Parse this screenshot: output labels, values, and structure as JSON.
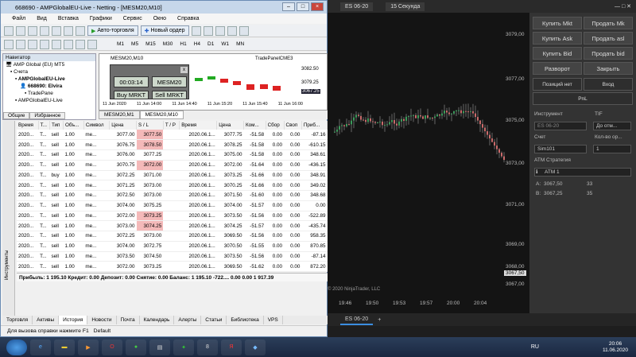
{
  "mt5": {
    "title": "668690 - AMPGlobalEU-Live - Netting - [MESM20,M10]",
    "menu": [
      "Файл",
      "Вид",
      "Вставка",
      "Графики",
      "Сервис",
      "Окно",
      "Справка"
    ],
    "toolbar": {
      "auto_trading": "Авто-торговля",
      "new_order": "Новый ордер"
    },
    "timeframes": [
      "M1",
      "M5",
      "M15",
      "M30",
      "H1",
      "H4",
      "D1",
      "W1",
      "MN"
    ],
    "navigator": {
      "title": "Навигатор",
      "items": [
        "AMP Global (EU) MT5",
        "Счета",
        "AMPGlobalEU-Live",
        "668690: Elvira",
        "TradePane",
        "AMPGlobalEU-Live"
      ],
      "tabs": [
        "Общие",
        "Избранное"
      ]
    },
    "chart": {
      "symbol": "MESM20,M10",
      "panel_label": "TradePanelCME3",
      "price_top": "3082.50",
      "price_mid": "3079.25",
      "price_current": "3067.25",
      "times": [
        "11 Jun 2020",
        "11 Jun 14:00",
        "11 Jun 14:40",
        "11 Jun 15:20",
        "11 Jun 15:40",
        "11 Jun 16:00"
      ],
      "tabs": [
        "MESM20,M1",
        "MESM20,M10"
      ]
    },
    "tradepanel": {
      "timer": "00:03:14",
      "symbol": "MESM20",
      "buy": "Buy MRKT",
      "sell": "Sell MRKT"
    },
    "table": {
      "headers": [
        "Время",
        "Т...",
        "Тип",
        "Объ...",
        "Символ",
        "Цена",
        "S / L",
        "T / P",
        "Время",
        "Цена",
        "Ком...",
        "Сбор",
        "Своп",
        "Приб..."
      ],
      "rows": [
        [
          "2020...",
          "T...",
          "sell",
          "1.00",
          "me...",
          "3077.00",
          "3077.50",
          "",
          "2020.06.1...",
          "3077.75",
          "-51.58",
          "0.00",
          "0.00",
          "-87.16"
        ],
        [
          "2020...",
          "T...",
          "sell",
          "1.00",
          "me...",
          "3076.75",
          "3078.50",
          "",
          "2020.06.1...",
          "3078.25",
          "-51.58",
          "0.00",
          "0.00",
          "-610.15"
        ],
        [
          "2020...",
          "T...",
          "sell",
          "1.00",
          "me...",
          "3076.00",
          "3077.25",
          "",
          "2020.06.1...",
          "3075.00",
          "-51.58",
          "0.00",
          "0.00",
          "348.61"
        ],
        [
          "2020...",
          "T...",
          "sell",
          "1.00",
          "me...",
          "3070.75",
          "3072.00",
          "",
          "2020.06.1...",
          "3072.00",
          "-51.64",
          "0.00",
          "0.00",
          "-436.15"
        ],
        [
          "2020...",
          "T...",
          "buy",
          "1.00",
          "me...",
          "3072.25",
          "3071.00",
          "",
          "2020.06.1...",
          "3073.25",
          "-51.66",
          "0.00",
          "0.00",
          "348.91"
        ],
        [
          "2020...",
          "T...",
          "sell",
          "1.00",
          "me...",
          "3071.25",
          "3073.00",
          "",
          "2020.06.1...",
          "3070.25",
          "-51.66",
          "0.00",
          "0.00",
          "349.02"
        ],
        [
          "2020...",
          "T...",
          "sell",
          "1.00",
          "me...",
          "3072.50",
          "3073.00",
          "",
          "2020.06.1...",
          "3071.50",
          "-51.60",
          "0.00",
          "0.00",
          "348.68"
        ],
        [
          "2020...",
          "T...",
          "sell",
          "1.00",
          "me...",
          "3074.00",
          "3075.25",
          "",
          "2020.06.1...",
          "3074.00",
          "-51.57",
          "0.00",
          "0.00",
          "0.00"
        ],
        [
          "2020...",
          "T...",
          "sell",
          "1.00",
          "me...",
          "3072.00",
          "3073.25",
          "",
          "2020.06.1...",
          "3073.50",
          "-51.56",
          "0.00",
          "0.00",
          "-522.89"
        ],
        [
          "2020...",
          "T...",
          "sell",
          "1.00",
          "me...",
          "3073.00",
          "3074.25",
          "",
          "2020.06.1...",
          "3074.25",
          "-51.57",
          "0.00",
          "0.00",
          "-435.74"
        ],
        [
          "2020...",
          "T...",
          "sell",
          "1.00",
          "me...",
          "3072.25",
          "3073.00",
          "",
          "2020.06.1...",
          "3069.50",
          "-51.56",
          "0.00",
          "0.00",
          "958.35"
        ],
        [
          "2020...",
          "T...",
          "sell",
          "1.00",
          "me...",
          "3074.00",
          "3072.75",
          "",
          "2020.06.1...",
          "3070.50",
          "-51.55",
          "0.00",
          "0.00",
          "870.85"
        ],
        [
          "2020...",
          "T...",
          "sell",
          "1.00",
          "me...",
          "3073.50",
          "3074.50",
          "",
          "2020.06.1...",
          "3073.50",
          "-51.56",
          "0.00",
          "0.00",
          "-87.14"
        ],
        [
          "2020...",
          "T...",
          "sell",
          "1.00",
          "me...",
          "3072.00",
          "3073.25",
          "",
          "2020.06.1...",
          "3069.50",
          "-51.62",
          "0.00",
          "0.00",
          "872.20"
        ]
      ],
      "highlight_rows": [
        0,
        1,
        3,
        8,
        9
      ]
    },
    "totals": "Прибыль: 1 195.10  Кредит: 0.00  Депозит: 0.00  Снятие: 0.00  Баланс: 1 195.10  -722....  0.00  0.00  1 917.39",
    "side_tool": "Инструменты",
    "bottom_tabs": [
      "Торговля",
      "Активы",
      "История",
      "Новости",
      "Почта",
      "Календарь",
      "Алерты",
      "Статьи",
      "Библиотека",
      "VPS"
    ],
    "active_tab": "История",
    "status": "Для вызова справки нажмите F1",
    "status2": "Default"
  },
  "nt": {
    "instrument_tab": "ES 06-20",
    "interval": "15 Секунда",
    "price_axis": [
      "3079,00",
      "3077,00",
      "3075,00",
      "3073,00",
      "3071,00",
      "3069,00",
      "3068,00",
      "3067,00"
    ],
    "price_marker": "3067,50",
    "time_axis": [
      "19:46",
      "19:50",
      "19:53",
      "19:57",
      "20:00",
      "20:04"
    ],
    "watermark": "© 2020 NinjaTrader, LLC",
    "bottom_tab": "ES 06-20",
    "buttons": {
      "buy_mkt": "Купить Mkt",
      "sell_mkt": "Продать Mk",
      "buy_ask": "Купить Ask",
      "sell_ask": "Продать asl",
      "buy_bid": "Купить Bid",
      "sell_bid": "Продать bid",
      "reverse": "Разворот",
      "close": "Закрыть"
    },
    "position": "Позиций нет",
    "entry": "Вход",
    "pnl": "PnL",
    "labels": {
      "instrument": "Инструмент",
      "tif": "TIF",
      "account": "Счет",
      "qty": "Кол-во ор...",
      "atm": "ATM Стратегия"
    },
    "values": {
      "instrument": "ES 06-20",
      "tif": "До отм...",
      "account": "Sim101",
      "qty": "1",
      "atm": "ATM 1"
    },
    "quotes": {
      "a_label": "A:",
      "a_price": "3067,50",
      "a_size": "33",
      "b_label": "B:",
      "b_price": "3067,25",
      "b_size": "35"
    }
  },
  "taskbar": {
    "lang": "RU",
    "time": "20:06",
    "date": "11.06.2020"
  }
}
